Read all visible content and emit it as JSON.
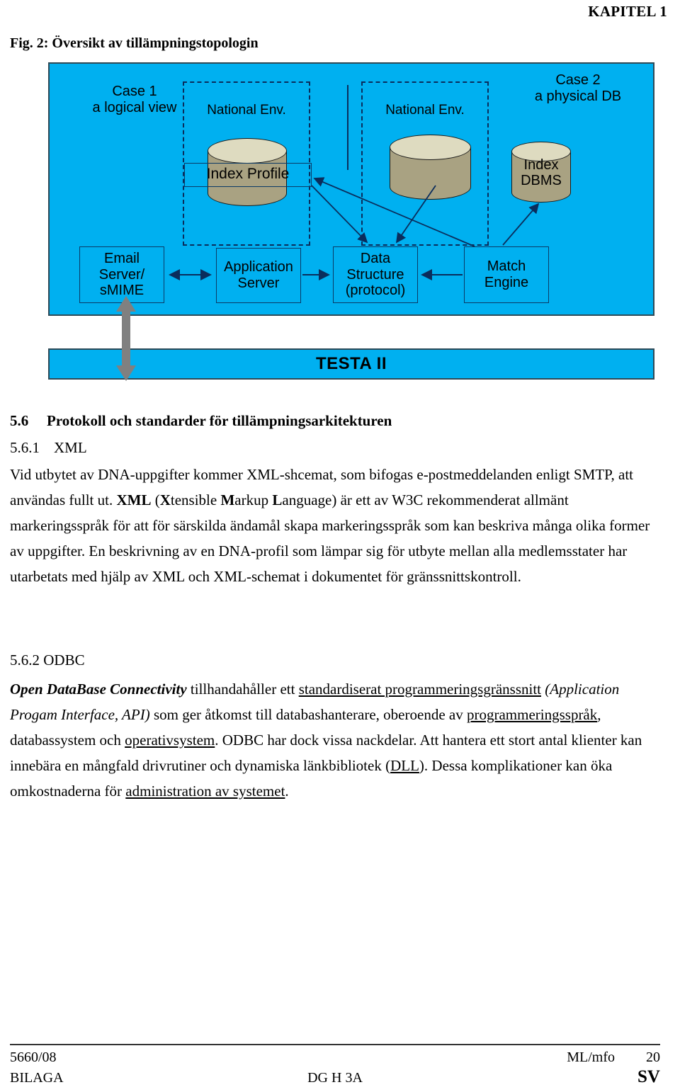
{
  "header": {
    "chapter": "KAPITEL 1"
  },
  "figure": {
    "caption": "Fig. 2: Översikt av tillämpningstopologin",
    "case1_label": "Case 1\na logical view",
    "case2_label": "Case 2\na physical DB",
    "national_env_1": "National Env.",
    "national_env_2": "National Env.",
    "index_profile_label": "Index Profile",
    "index_dbms_label": "Index\nDBMS",
    "boxes": {
      "email": "Email\nServer/\nsMIME",
      "app_server": "Application\nServer",
      "data_structure": "Data\nStructure\n(protocol)",
      "match_engine": "Match\nEngine"
    },
    "network_bar": "TESTA II",
    "colors": {
      "panel_fill": "#00b0f0",
      "panel_border": "#2e4a57",
      "cylinder_body": "#a9a282",
      "cylinder_top": "#dedbc0",
      "line": "#0b2d5c",
      "grey_arrow": "#808080"
    }
  },
  "sections": {
    "s56_number": "5.6",
    "s56_title": "Protokoll och standarder för tillämpningsarkitekturen",
    "s561_number": "5.6.1",
    "s561_title": "XML",
    "xml_p1_a": "Vid utbytet av DNA-uppgifter kommer XML-shcemat, som bifogas e-postmeddelanden enligt SMTP, att användas fullt ut. ",
    "xml_p1_b_xml": "XML",
    "xml_p1_c": " (",
    "xml_p1_d_x": "X",
    "xml_p1_e": "tensible ",
    "xml_p1_f_m": "M",
    "xml_p1_g": "arkup ",
    "xml_p1_h_l": "L",
    "xml_p1_i": "anguage) är ett av W3C rekommenderat allmänt markeringsspråk för att för särskilda ändamål skapa markeringsspråk som kan beskriva många olika former av uppgifter. En beskrivning av en DNA-profil som lämpar sig för utbyte mellan alla medlemsstater har utarbetats med hjälp av XML och XML-schemat i dokumentet för gränssnittskontroll.",
    "s562_heading": "5.6.2 ODBC",
    "odbc_a_italic": "Open DataBase Connectivity",
    "odbc_b": " tillhandahåller ett ",
    "odbc_c_underline": "standardiserat programmeringsgränssnitt",
    "odbc_d": " ",
    "odbc_e_italic": "(Application Progam Interface, API)",
    "odbc_f": " som ger åtkomst till databashanterare, oberoende av ",
    "odbc_g_underline": "programmeringsspråk",
    "odbc_h": ", databassystem och ",
    "odbc_i_underline": "operativsystem",
    "odbc_j": ". ODBC har dock vissa nackdelar. Att hantera ett stort antal klienter kan innebära en mångfald drivrutiner och dynamiska länkbibliotek (",
    "odbc_k_underline": "DLL",
    "odbc_l": "). Dessa komplikationer kan öka omkostnaderna för ",
    "odbc_m_underline": "administration av systemet",
    "odbc_n": "."
  },
  "footer": {
    "doc_number": "5660/08",
    "annex": "BILAGA",
    "dg": "DG H 3A",
    "initials": "ML/mfo",
    "page_number": "20",
    "language": "SV"
  }
}
